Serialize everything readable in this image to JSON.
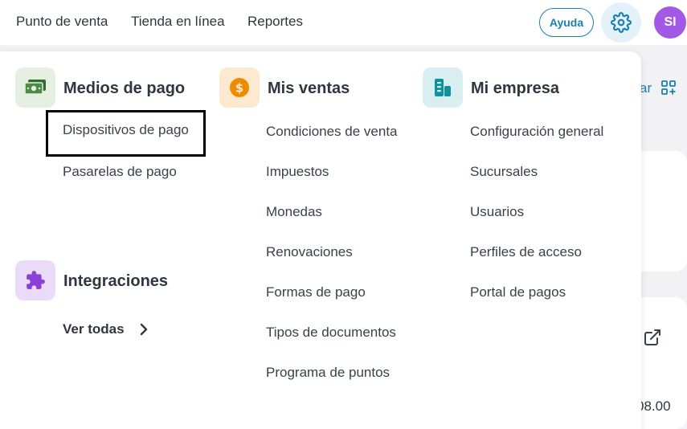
{
  "topbar": {
    "nav": [
      "Punto de venta",
      "Tienda en línea",
      "Reportes"
    ],
    "help_label": "Ayuda",
    "avatar_initials": "SI"
  },
  "background": {
    "link_fragment": "ar",
    "amount_fragment": "08.00"
  },
  "menu": {
    "payment": {
      "title": "Medios de pago",
      "items": [
        "Dispositivos de pago",
        "Pasarelas de pago"
      ]
    },
    "integrations": {
      "title": "Integraciones",
      "see_all": "Ver todas"
    },
    "sales": {
      "title": "Mis ventas",
      "items": [
        "Condiciones de venta",
        "Impuestos",
        "Monedas",
        "Renovaciones",
        "Formas de pago",
        "Tipos de documentos",
        "Programa de puntos"
      ]
    },
    "company": {
      "title": "Mi empresa",
      "items": [
        "Configuración general",
        "Sucursales",
        "Usuarios",
        "Perfiles de acceso",
        "Portal de pagos"
      ]
    }
  },
  "colors": {
    "accent": "#1a7fb3",
    "avatar": "#a259e6",
    "payment_icon_bg": "#e5efe2",
    "sales_icon_bg": "#fde9cf",
    "company_icon_bg": "#d9eef0",
    "integrations_icon_bg": "#eadbf8"
  }
}
